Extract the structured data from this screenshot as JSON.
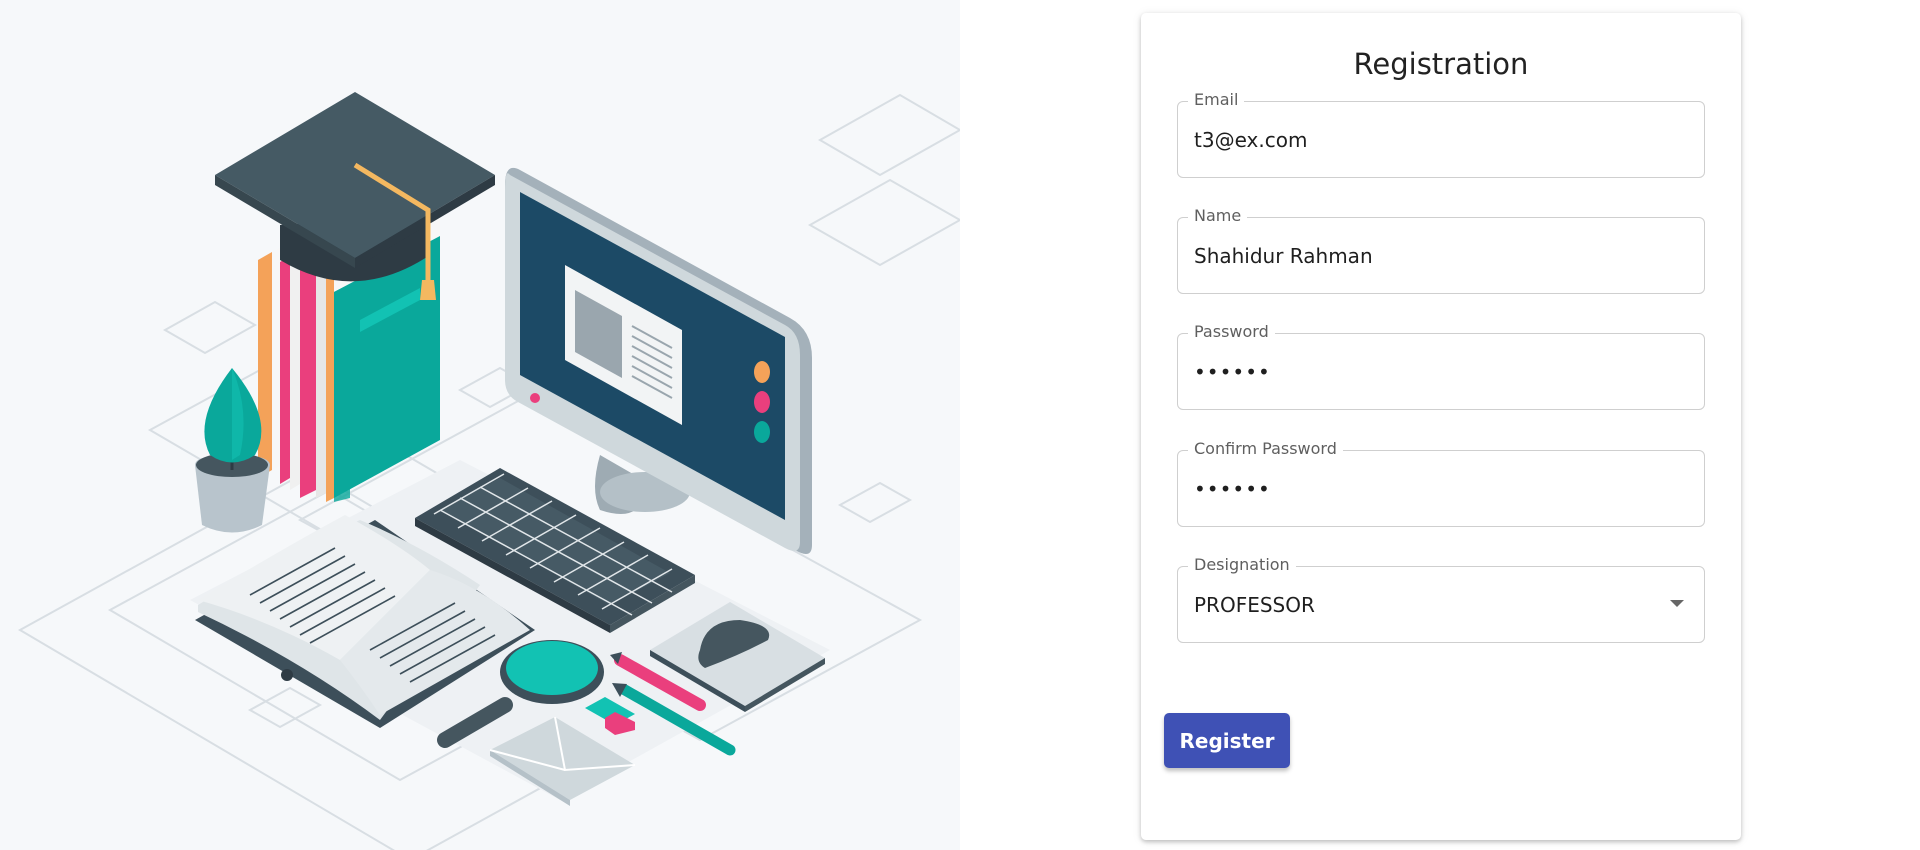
{
  "illustration": {
    "name": "education-illustration",
    "colors": {
      "background": "#f6f8fa",
      "dark_slate": "#3d4f5a",
      "teal": "#0aa89b",
      "teal_light": "#12c2b3",
      "pink": "#ea3f7d",
      "orange": "#f4a259",
      "screen": "#1c4a66",
      "monitor_frame": "#cfd8dc",
      "outline": "#d8dee3"
    }
  },
  "form": {
    "title": "Registration",
    "fields": {
      "email": {
        "label": "Email",
        "value": "t3@ex.com"
      },
      "name": {
        "label": "Name",
        "value": "Shahidur Rahman"
      },
      "password": {
        "label": "Password",
        "value": "••••••"
      },
      "confirm_password": {
        "label": "Confirm Password",
        "value": "••••••"
      },
      "designation": {
        "label": "Designation",
        "value": "PROFESSOR"
      }
    },
    "submit_label": "Register",
    "colors": {
      "primary": "#3f51b5",
      "border": "#cfcfcf",
      "label": "#5f5f5f",
      "text": "#1f1f1f"
    }
  }
}
